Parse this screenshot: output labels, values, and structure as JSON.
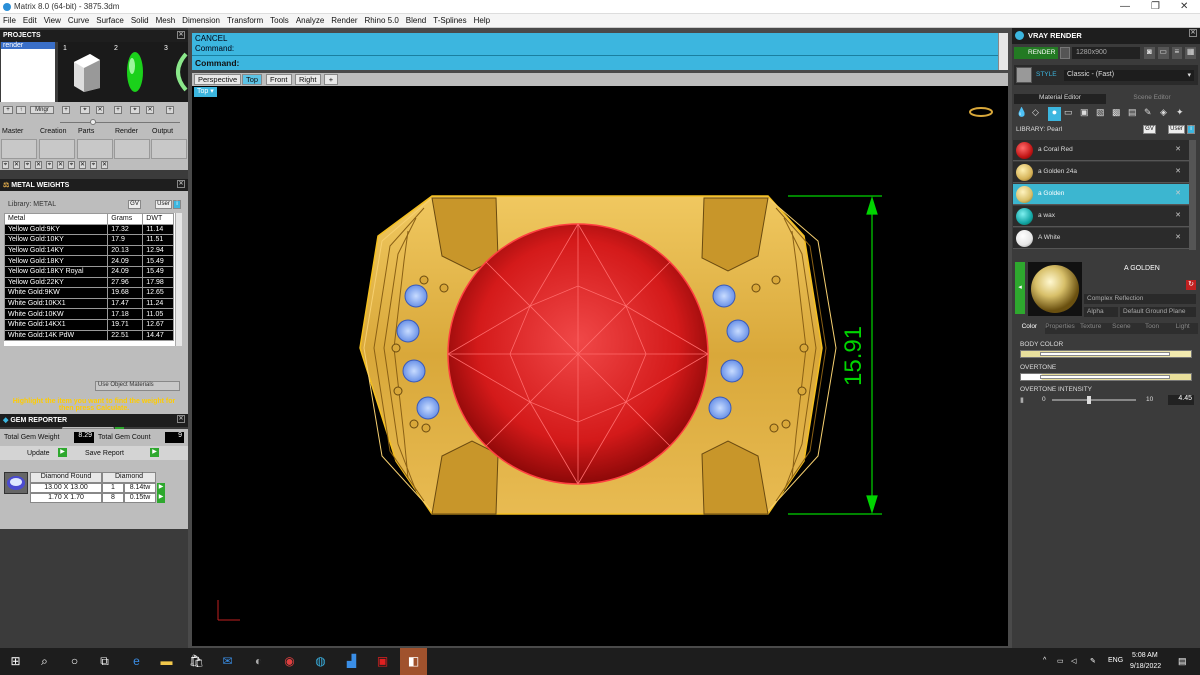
{
  "window": {
    "title": "Matrix 8.0 (64-bit) - 3875.3dm",
    "minimize": "—",
    "restore": "❐",
    "close": "✕"
  },
  "menu": [
    "File",
    "Edit",
    "View",
    "Curve",
    "Surface",
    "Solid",
    "Mesh",
    "Dimension",
    "Transform",
    "Tools",
    "Analyze",
    "Render",
    "Rhino 5.0",
    "Blend",
    "T-Splines",
    "Help"
  ],
  "projects": {
    "header": "PROJECTS",
    "selected_item": "render",
    "thumb_numbers": [
      "1",
      "2",
      "3"
    ],
    "manage_button": "Mngr"
  },
  "tabs_groups": [
    "Master",
    "Creation",
    "Parts",
    "Render",
    "Output"
  ],
  "metal_weights": {
    "header": "METAL WEIGHTS",
    "library_label": "Library: METAL",
    "gv_label": "GV",
    "user_label": "User",
    "columns": [
      "Metal",
      "Grams",
      "DWT"
    ],
    "rows": [
      {
        "metal": "Yellow Gold:9KY",
        "grams": "17.32",
        "dwt": "11.14"
      },
      {
        "metal": "Yellow Gold:10KY",
        "grams": "17.9",
        "dwt": "11.51"
      },
      {
        "metal": "Yellow Gold:14KY",
        "grams": "20.13",
        "dwt": "12.94"
      },
      {
        "metal": "Yellow Gold:18KY",
        "grams": "24.09",
        "dwt": "15.49"
      },
      {
        "metal": "Yellow Gold:18KY Royal",
        "grams": "24.09",
        "dwt": "15.49"
      },
      {
        "metal": "Yellow Gold:22KY",
        "grams": "27.96",
        "dwt": "17.98"
      },
      {
        "metal": "White Gold:9KW",
        "grams": "19.68",
        "dwt": "12.65"
      },
      {
        "metal": "White Gold:10KX1",
        "grams": "17.47",
        "dwt": "11.24"
      },
      {
        "metal": "White Gold:10KW",
        "grams": "17.18",
        "dwt": "11.05"
      },
      {
        "metal": "White Gold:14KX1",
        "grams": "19.71",
        "dwt": "12.67"
      },
      {
        "metal": "White Gold:14K PdW",
        "grams": "22.51",
        "dwt": "14.47"
      }
    ],
    "use_object_materials": "Use Object Materials",
    "hint": "Highlight the item you want to find the weight for then press Calculate.",
    "calculate_button": "Calculate"
  },
  "gem_reporter": {
    "header": "GEM REPORTER",
    "total_weight_label": "Total Gem Weight",
    "total_weight_value": "8.29",
    "total_count_label": "Total Gem Count",
    "total_count_value": "9",
    "update_button": "Update",
    "save_report_button": "Save Report",
    "col_shape": "Diamond Round",
    "col_material": "Diamond",
    "rows": [
      {
        "size": "13.00 X 13.00",
        "count": "1",
        "weight": "8.14tw"
      },
      {
        "size": "1.70 X 1.70",
        "count": "8",
        "weight": "0.15tw"
      }
    ]
  },
  "command": {
    "line1": "CANCEL",
    "line2": "Command:",
    "prompt": "Command:"
  },
  "viewport_tabs": [
    "Perspective",
    "Top",
    "Front",
    "Right"
  ],
  "active_view": "Top",
  "dimension": "15.91",
  "vray": {
    "header": "VRAY RENDER",
    "render_button": "RENDER",
    "resolution": "1280x900",
    "style_label": "STYLE",
    "style_value": "Classic - (Fast)",
    "tabs": [
      "Material Editor",
      "Scene Editor"
    ],
    "library_label": "LIBRARY: Pearl",
    "materials": [
      {
        "name": "a Coral Red",
        "color": "#c21616"
      },
      {
        "name": "a Golden 24a",
        "color": "#d6b45a"
      },
      {
        "name": "a Golden",
        "color": "#d8c06a"
      },
      {
        "name": "a wax",
        "color": "#14a6a6"
      },
      {
        "name": "A White",
        "color": "#e6e6e6"
      }
    ],
    "selected_material": "A GOLDEN",
    "reflection_mode": "Complex Reflection",
    "alpha_label": "Alpha",
    "ground_plane": "Default Ground Plane",
    "sub_tabs": [
      "Color",
      "Properties",
      "Texture",
      "Scene",
      "Toon",
      "Light"
    ],
    "body_color_label": "BODY COLOR",
    "overtone_label": "OVERTONE",
    "overtone_intensity_label": "OVERTONE INTENSITY",
    "intensity_min": "0",
    "intensity_max": "10",
    "intensity_value": "4.45"
  },
  "taskbar": {
    "lang": "ENG",
    "time": "5:08 AM",
    "date": "9/18/2022"
  },
  "colors": {
    "accent": "#3cb6df",
    "panel": "#3b3b3b",
    "gold": "#d4a93a",
    "ruby": "#d21818",
    "dimension": "#00d400"
  }
}
